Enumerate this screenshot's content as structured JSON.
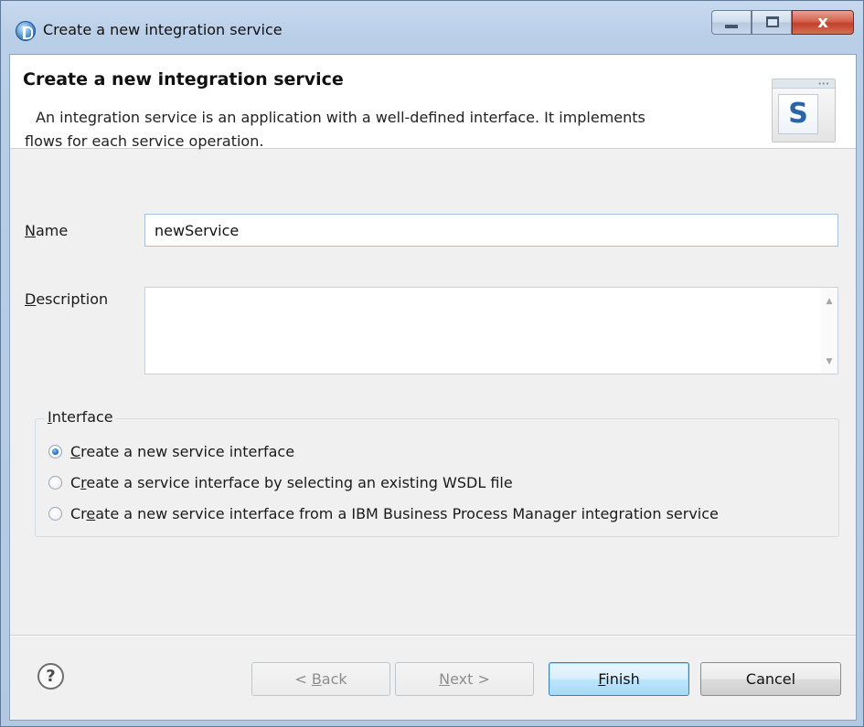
{
  "window": {
    "title": "Create a new integration service",
    "close_glyph": "x"
  },
  "header": {
    "title": "Create a new integration service",
    "description_line1": "An integration service is an application with a well-defined interface. It implements",
    "description_line2": "flows for each service operation.",
    "banner_letter": "S"
  },
  "form": {
    "name_label_mnemonic": "N",
    "name_label_rest": "ame",
    "name_value": "newService",
    "description_label_mnemonic": "D",
    "description_label_rest": "escription",
    "description_value": ""
  },
  "interface": {
    "group_label_mnemonic": "I",
    "group_label_rest": "nterface",
    "options": [
      {
        "pre": "",
        "mnemonic": "C",
        "post": "reate a new service interface",
        "checked": true
      },
      {
        "pre": "C",
        "mnemonic": "r",
        "post": "eate a service interface by selecting an existing WSDL file",
        "checked": false
      },
      {
        "pre": "Cr",
        "mnemonic": "e",
        "post": "ate a new service interface from a IBM Business Process Manager integration service",
        "checked": false
      }
    ]
  },
  "footer": {
    "help_glyph": "?",
    "back_pre": "< ",
    "back_mnemonic": "B",
    "back_post": "ack",
    "next_mnemonic": "N",
    "next_post": "ext >",
    "finish_mnemonic": "F",
    "finish_post": "inish",
    "cancel_label": "Cancel"
  }
}
